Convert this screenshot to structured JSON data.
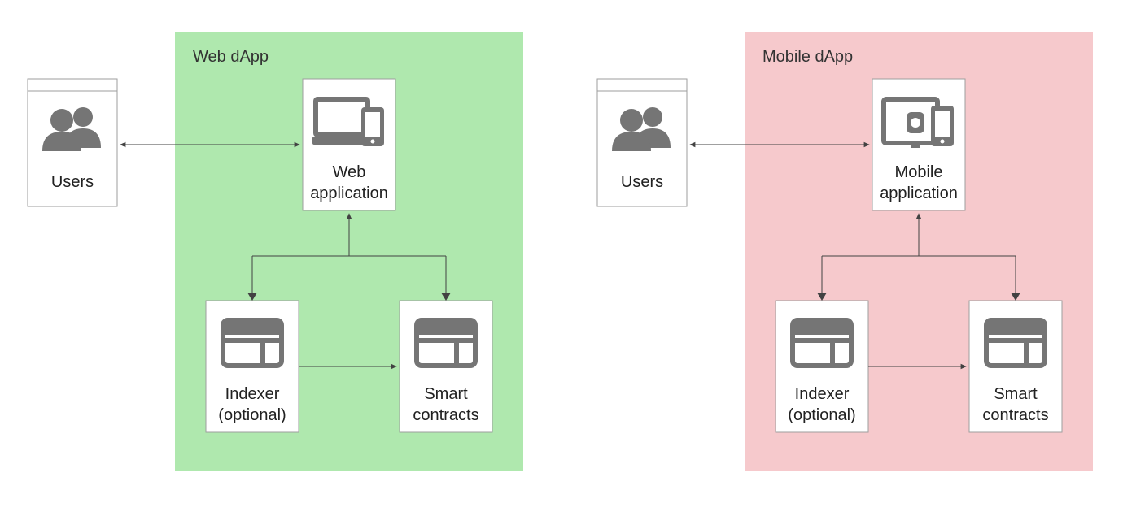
{
  "diagram": {
    "left": {
      "container_title": "Web dApp",
      "container_fill": "#AFE8AE",
      "actor": {
        "label": "Users"
      },
      "app": {
        "label_line1": "Web",
        "label_line2": "application"
      },
      "indexer": {
        "label_line1": "Indexer",
        "label_line2": "(optional)"
      },
      "contracts": {
        "label_line1": "Smart",
        "label_line2": "contracts"
      }
    },
    "right": {
      "container_title": "Mobile dApp",
      "container_fill": "#F6C9CC",
      "actor": {
        "label": "Users"
      },
      "app": {
        "label_line1": "Mobile",
        "label_line2": "application"
      },
      "indexer": {
        "label_line1": "Indexer",
        "label_line2": "(optional)"
      },
      "contracts": {
        "label_line1": "Smart",
        "label_line2": "contracts"
      }
    }
  }
}
